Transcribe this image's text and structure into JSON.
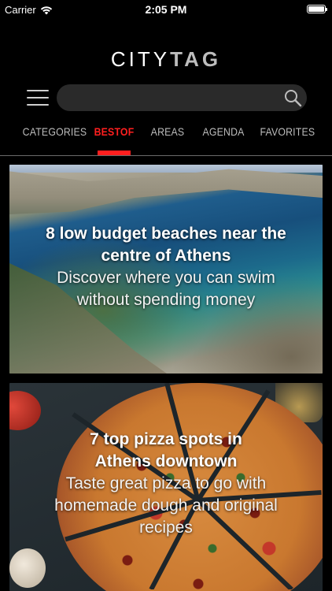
{
  "status_bar": {
    "carrier": "Carrier",
    "time": "2:05 PM"
  },
  "header": {
    "logo_part1": "CITY",
    "logo_part2": "TAG"
  },
  "search": {
    "value": "",
    "placeholder": ""
  },
  "tabs": [
    {
      "label": "CATEGORIES",
      "active": false
    },
    {
      "label": "BESTOF",
      "active": true
    },
    {
      "label": "AREAS",
      "active": false
    },
    {
      "label": "AGENDA",
      "active": false
    },
    {
      "label": "FAVORITES",
      "active": false
    }
  ],
  "cards": [
    {
      "title": "8 low budget beaches near the centre of Athens",
      "subtitle": "Discover where you can swim without spending money"
    },
    {
      "title": "7 top pizza spots in Athens downtown",
      "subtitle": "Taste great pizza to go with homemade dough and original recipes"
    }
  ],
  "colors": {
    "accent": "#ff1f1f",
    "background": "#000000",
    "tab_text": "#bcbcbc"
  }
}
